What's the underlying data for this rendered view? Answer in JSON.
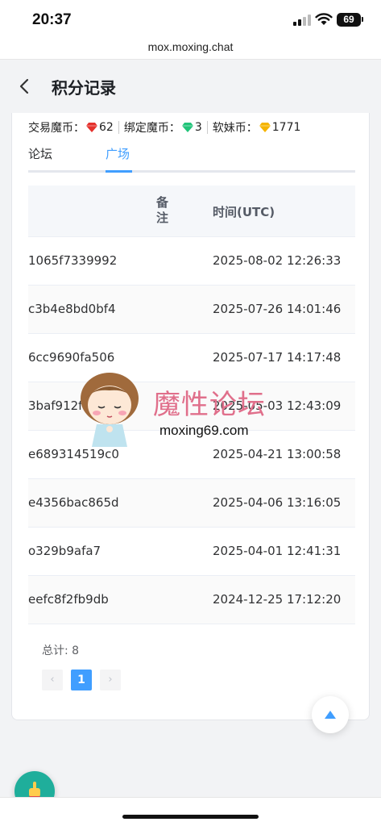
{
  "status_bar": {
    "time": "20:37",
    "battery": "69"
  },
  "browser": {
    "url": "mox.moxing.chat"
  },
  "header": {
    "title": "积分记录"
  },
  "balances": [
    {
      "label": "交易魔币：",
      "icon": "red-gem-icon",
      "color": "#e5322d",
      "value": "62"
    },
    {
      "label": "绑定魔币：",
      "icon": "green-gem-icon",
      "color": "#22c47a",
      "value": "3"
    },
    {
      "label": "软妹币：",
      "icon": "gold-gem-icon",
      "color": "#f5b400",
      "value": "1771"
    }
  ],
  "tabs": [
    {
      "label": "论坛",
      "active": false
    },
    {
      "label": "广场",
      "active": true
    }
  ],
  "table": {
    "headers": {
      "note": "备注",
      "time": "时间(UTC)"
    },
    "rows": [
      {
        "id": "1065f7339992",
        "time": "2025-08-02 12:26:33"
      },
      {
        "id": "c3b4e8bd0bf4",
        "time": "2025-07-26 14:01:46"
      },
      {
        "id": "6cc9690fa506",
        "time": "2025-07-17 14:17:48"
      },
      {
        "id": "3baf912f1",
        "time": "2025-05-03 12:43:09"
      },
      {
        "id": "e689314519c0",
        "time": "2025-04-21 13:00:58"
      },
      {
        "id": "e4356bac865d",
        "time": "2025-04-06 13:16:05"
      },
      {
        "id": "o329b9afa7",
        "time": "2025-04-01 12:41:31"
      },
      {
        "id": "eefc8f2fb9db",
        "time": "2024-12-25 17:12:20"
      }
    ]
  },
  "pagination": {
    "total": "总计: 8",
    "prev": "‹",
    "current": "1",
    "next": "›"
  },
  "watermark": {
    "title": "魔性论坛",
    "url": "moxing69.com"
  },
  "colors": {
    "accent": "#409eff",
    "fab": "#1fae9b",
    "watermark": "#e06f8b"
  }
}
